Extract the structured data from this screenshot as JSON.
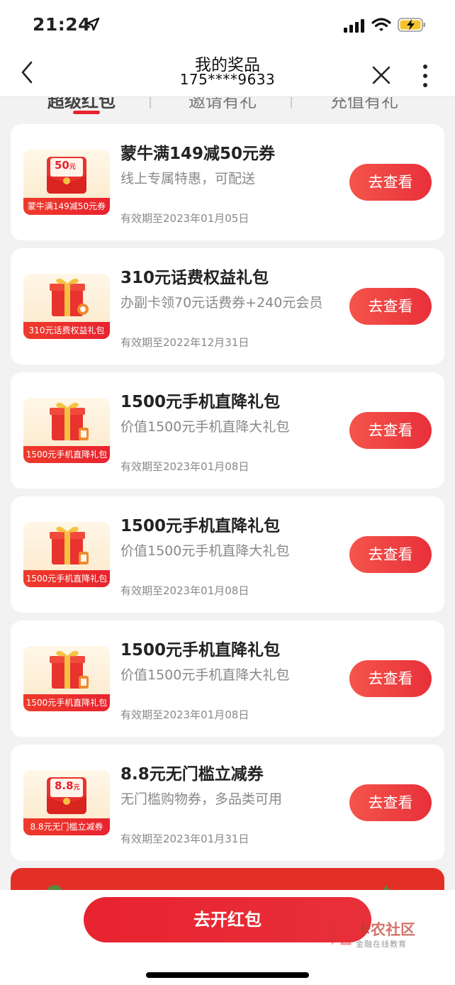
{
  "status_bar": {
    "time": "21:24"
  },
  "header": {
    "title": "我的奖品",
    "subtitle": "175****9633"
  },
  "tabs": [
    "超级红包",
    "邀请有礼",
    "充值有礼"
  ],
  "cards": [
    {
      "thumb_label": "蒙牛满149减50元券",
      "thumb_value": "50",
      "thumb_unit": "元",
      "title": "蒙牛满149减50元券",
      "desc": "线上专属特惠，可配送",
      "expiry": "有效期至2023年01月05日",
      "button": "去查看"
    },
    {
      "thumb_label": "310元话费权益礼包",
      "title": "310元话费权益礼包",
      "desc": "办副卡领70元话费券+240元会员",
      "expiry": "有效期至2022年12月31日",
      "button": "去查看"
    },
    {
      "thumb_label": "1500元手机直降礼包",
      "title": "1500元手机直降礼包",
      "desc": "价值1500元手机直降大礼包",
      "expiry": "有效期至2023年01月08日",
      "button": "去查看"
    },
    {
      "thumb_label": "1500元手机直降礼包",
      "title": "1500元手机直降礼包",
      "desc": "价值1500元手机直降大礼包",
      "expiry": "有效期至2023年01月08日",
      "button": "去查看"
    },
    {
      "thumb_label": "1500元手机直降礼包",
      "title": "1500元手机直降礼包",
      "desc": "价值1500元手机直降大礼包",
      "expiry": "有效期至2023年01月08日",
      "button": "去查看"
    },
    {
      "thumb_label": "8.8元无门槛立减券",
      "thumb_value": "8.8",
      "thumb_unit": "元",
      "title": "8.8元无门槛立减券",
      "desc": "无门槛购物券，多品类可用",
      "expiry": "有效期至2023年01月31日",
      "button": "去查看"
    }
  ],
  "bottom": {
    "open_button": "去开红包"
  },
  "watermark": {
    "name": "卡农社区",
    "tagline": "金融在线教育"
  },
  "colors": {
    "accent": "#e8232f",
    "background": "#f2f2f2"
  }
}
